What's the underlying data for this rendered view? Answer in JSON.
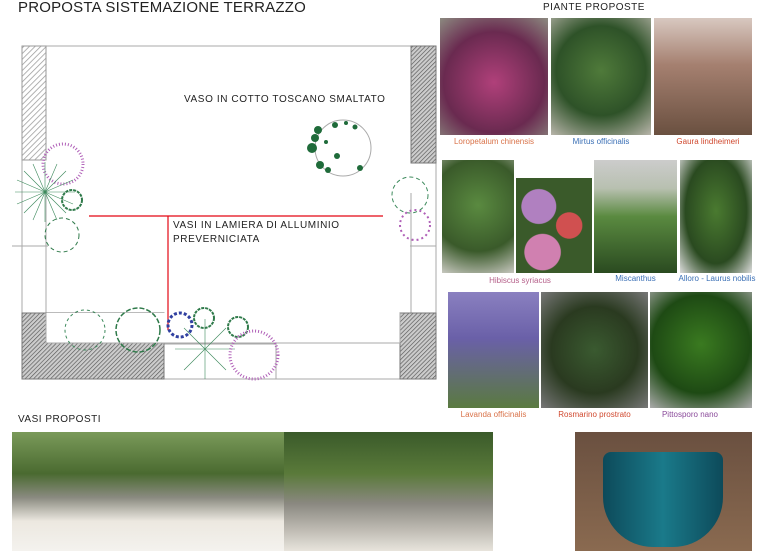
{
  "title": "PROPOSTA SISTEMAZIONE TERRAZZO",
  "plants_heading": "PIANTE PROPOSTE",
  "pots_heading": "VASI PROPOSTI",
  "plan": {
    "note_cotto": "VASO IN COTTO TOSCANO SMALTATO",
    "note_lamiera_1": "VASI IN LAMIERA DI ALLUMINIO",
    "note_lamiera_2": "PREVERNICIATA",
    "leader_color": "#e30613"
  },
  "plants": [
    {
      "name": "Loropetalum  chinensis",
      "color": "#d9734a"
    },
    {
      "name": "Mirtus officinalis",
      "color": "#3a6fb5"
    },
    {
      "name": "Gaura lindheimeri",
      "color": "#d0492f"
    },
    {
      "name": "Hibiscus syriacus",
      "color": "#b5608a"
    },
    {
      "name": "Miscanthus",
      "color": "#3a6fb5"
    },
    {
      "name": "Alloro - Laurus  nobilis",
      "color": "#3a6fb5"
    },
    {
      "name": "Lavanda  officinalis",
      "color": "#d9734a"
    },
    {
      "name": "Rosmarino  prostrato",
      "color": "#d0492f"
    },
    {
      "name": "Pittosporo  nano",
      "color": "#8a4a9a"
    }
  ]
}
